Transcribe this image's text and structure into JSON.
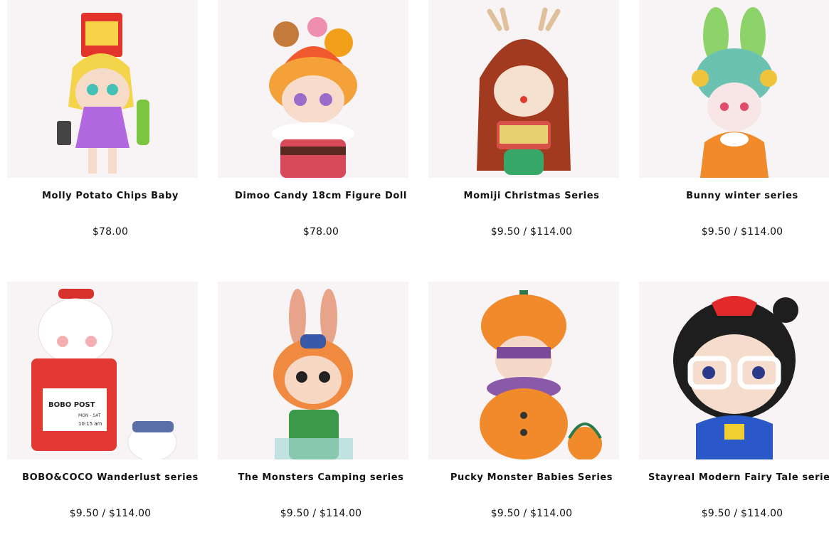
{
  "products": [
    {
      "name": "Molly Potato Chips Baby",
      "price": "$78.00",
      "icon": "figure-molly-icon"
    },
    {
      "name": "Dimoo Candy 18cm Figure Doll",
      "price": "$78.00",
      "icon": "figure-dimoo-icon"
    },
    {
      "name": "Momiji Christmas Series",
      "price": "$9.50 / $114.00",
      "icon": "figure-momiji-icon"
    },
    {
      "name": "Bunny winter series",
      "price": "$9.50 / $114.00",
      "icon": "figure-bunny-icon"
    },
    {
      "name": "BOBO&COCO Wanderlust series",
      "price": "$9.50 / $114.00",
      "icon": "figure-bobo-coco-icon",
      "image_text": [
        "BOBO POST",
        "MON - SAT",
        "10:15 am"
      ]
    },
    {
      "name": "The Monsters Camping series",
      "price": "$9.50 / $114.00",
      "icon": "figure-labubu-icon"
    },
    {
      "name": "Pucky Monster Babies Series",
      "price": "$9.50 / $114.00",
      "icon": "figure-pucky-icon"
    },
    {
      "name": "Stayreal Modern Fairy Tale series",
      "price": "$9.50 / $114.00",
      "icon": "figure-stayreal-icon"
    }
  ],
  "colors": {
    "tile_bg": "#f8f3f4",
    "text": "#111111"
  }
}
